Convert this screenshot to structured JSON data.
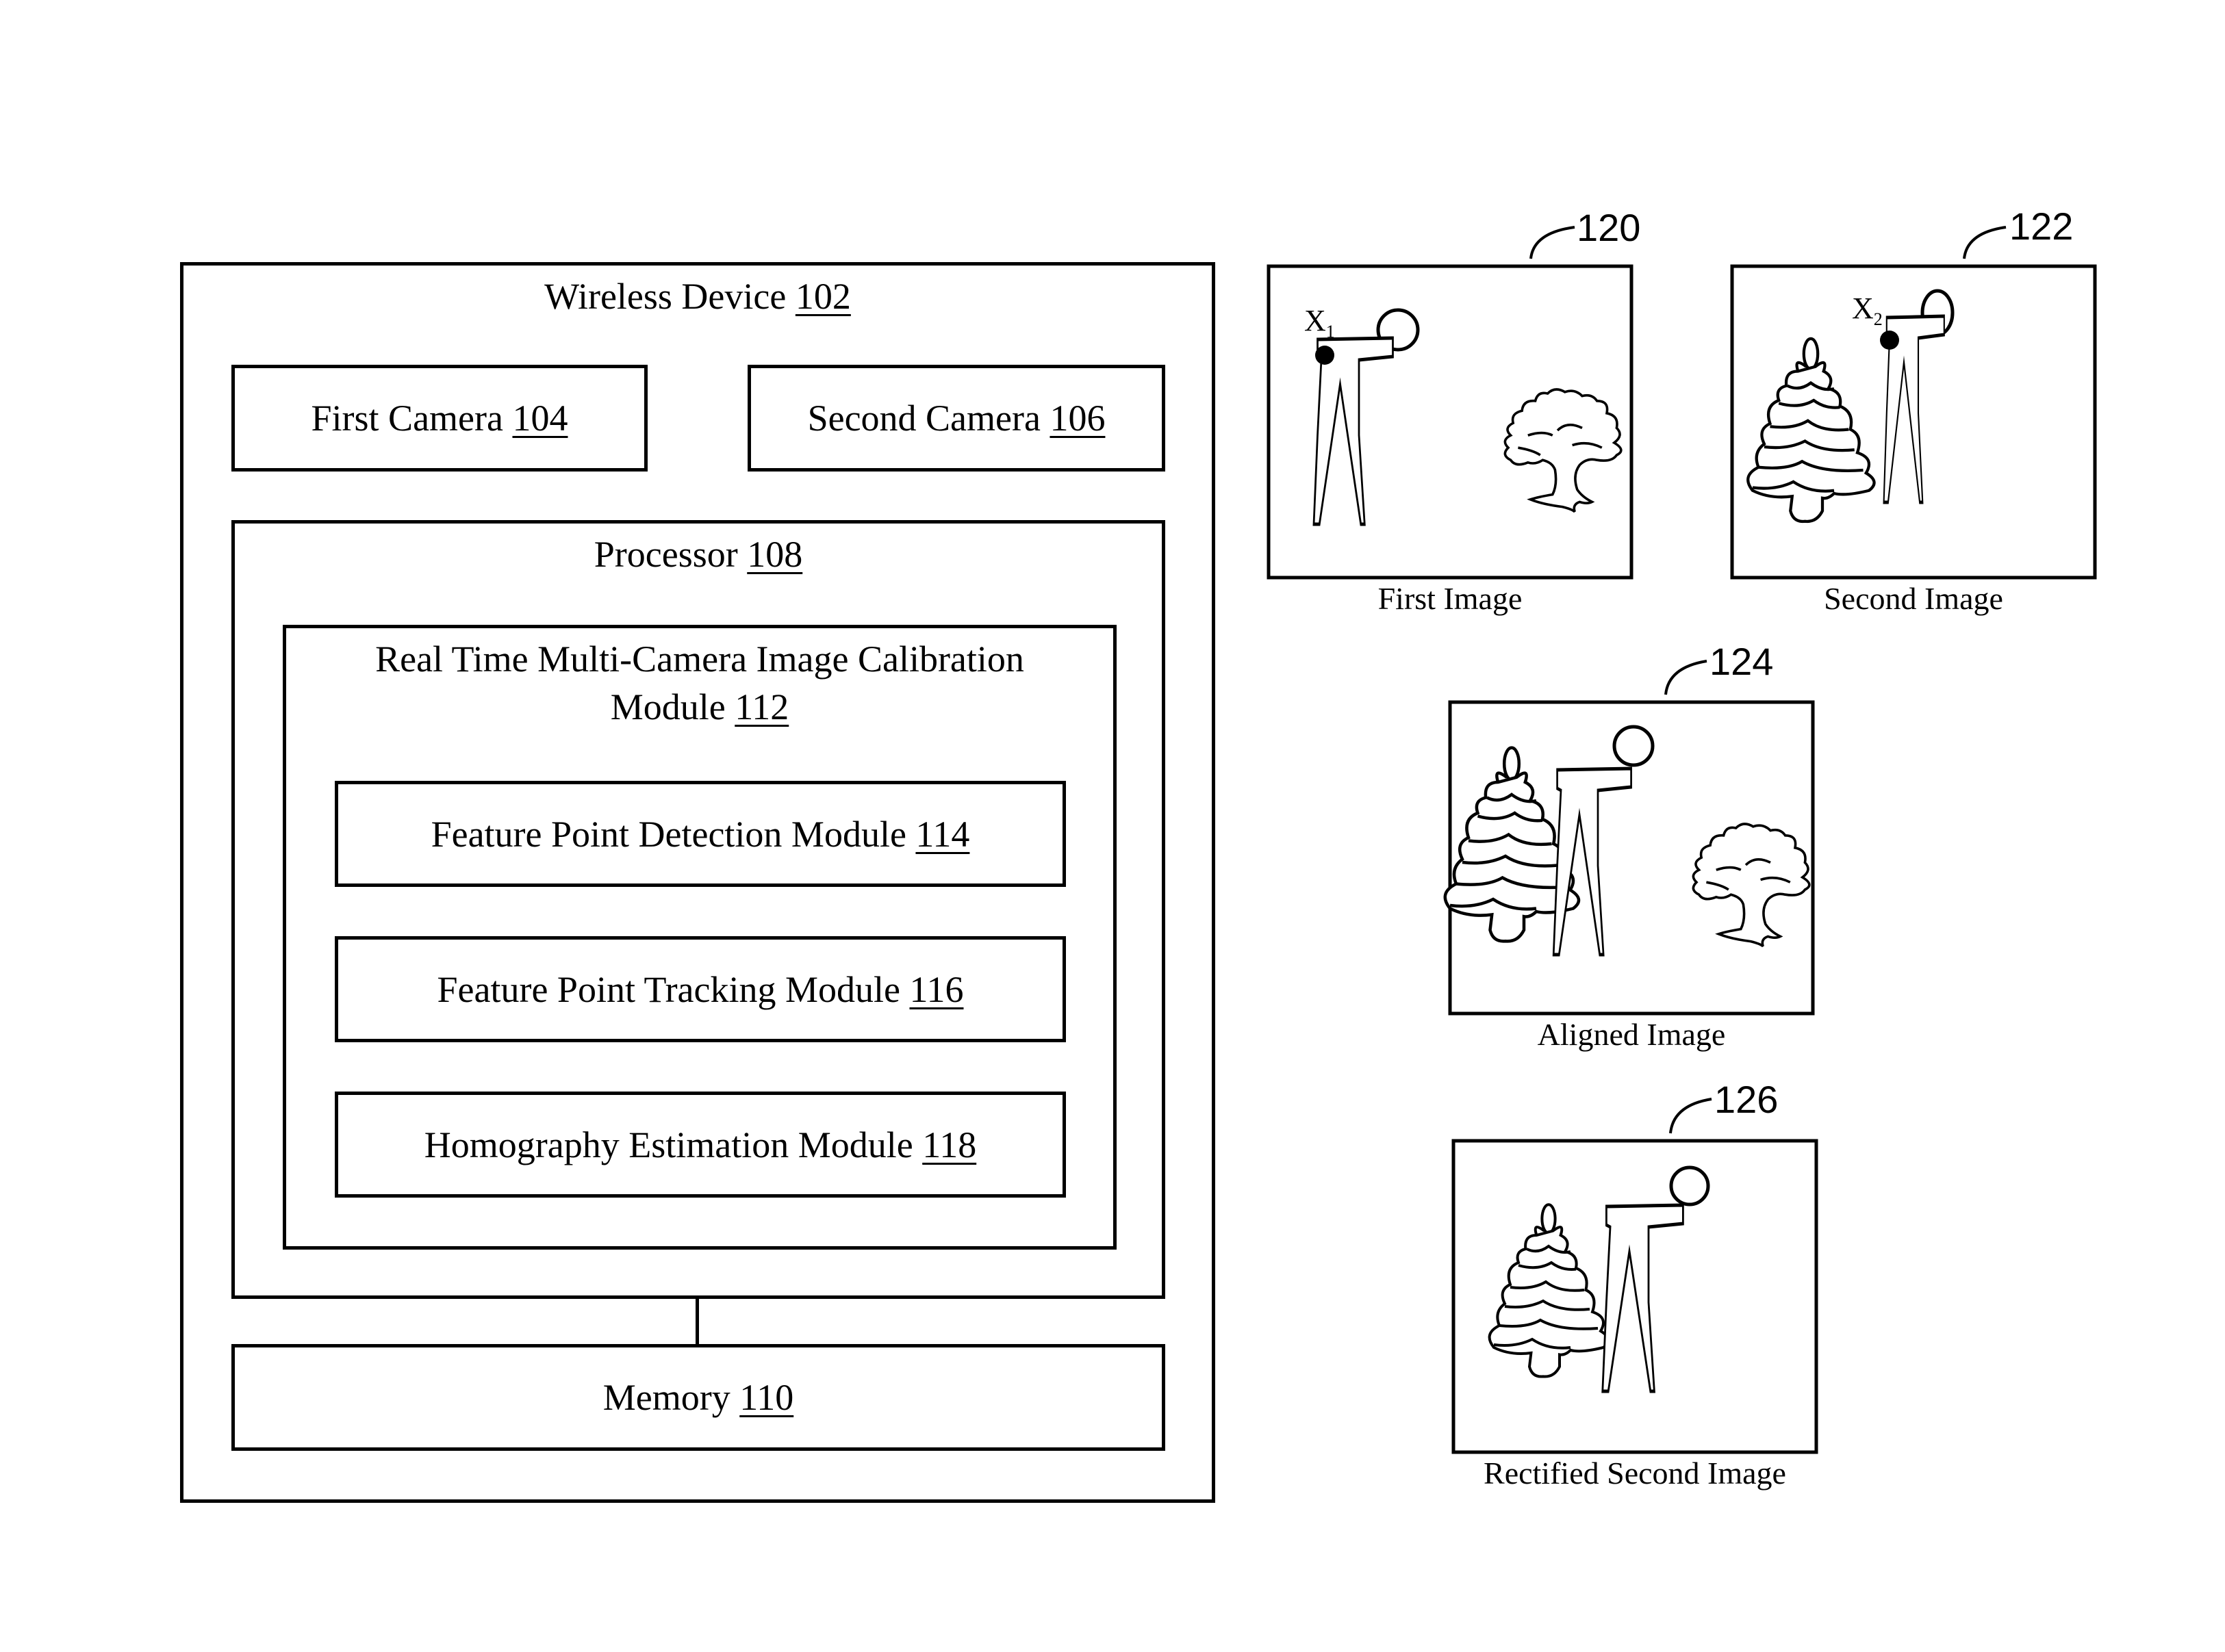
{
  "wireless_device": {
    "label": "Wireless Device",
    "ref": "102",
    "first_camera": {
      "label": "First Camera",
      "ref": "104"
    },
    "second_camera": {
      "label": "Second Camera",
      "ref": "106"
    },
    "processor": {
      "label": "Processor",
      "ref": "108",
      "calibration_module": {
        "label_line1": "Real Time Multi-Camera Image Calibration",
        "label_line2": "Module",
        "ref": "112",
        "submodules": [
          {
            "label": "Feature Point Detection Module",
            "ref": "114"
          },
          {
            "label": "Feature Point Tracking Module",
            "ref": "116"
          },
          {
            "label": "Homography Estimation Module",
            "ref": "118"
          }
        ]
      }
    },
    "memory": {
      "label": "Memory",
      "ref": "110"
    }
  },
  "images": [
    {
      "ref": "120",
      "caption": "First Image",
      "point_label": "X",
      "point_sub": "1",
      "contents": [
        "person-icon",
        "deciduous-tree-icon"
      ]
    },
    {
      "ref": "122",
      "caption": "Second Image",
      "point_label": "X",
      "point_sub": "2",
      "contents": [
        "pine-tree-icon",
        "person-icon"
      ]
    },
    {
      "ref": "124",
      "caption": "Aligned Image",
      "contents": [
        "pine-tree-icon",
        "person-icon",
        "deciduous-tree-icon"
      ]
    },
    {
      "ref": "126",
      "caption": "Rectified Second Image",
      "contents": [
        "pine-tree-icon",
        "person-icon"
      ]
    }
  ]
}
